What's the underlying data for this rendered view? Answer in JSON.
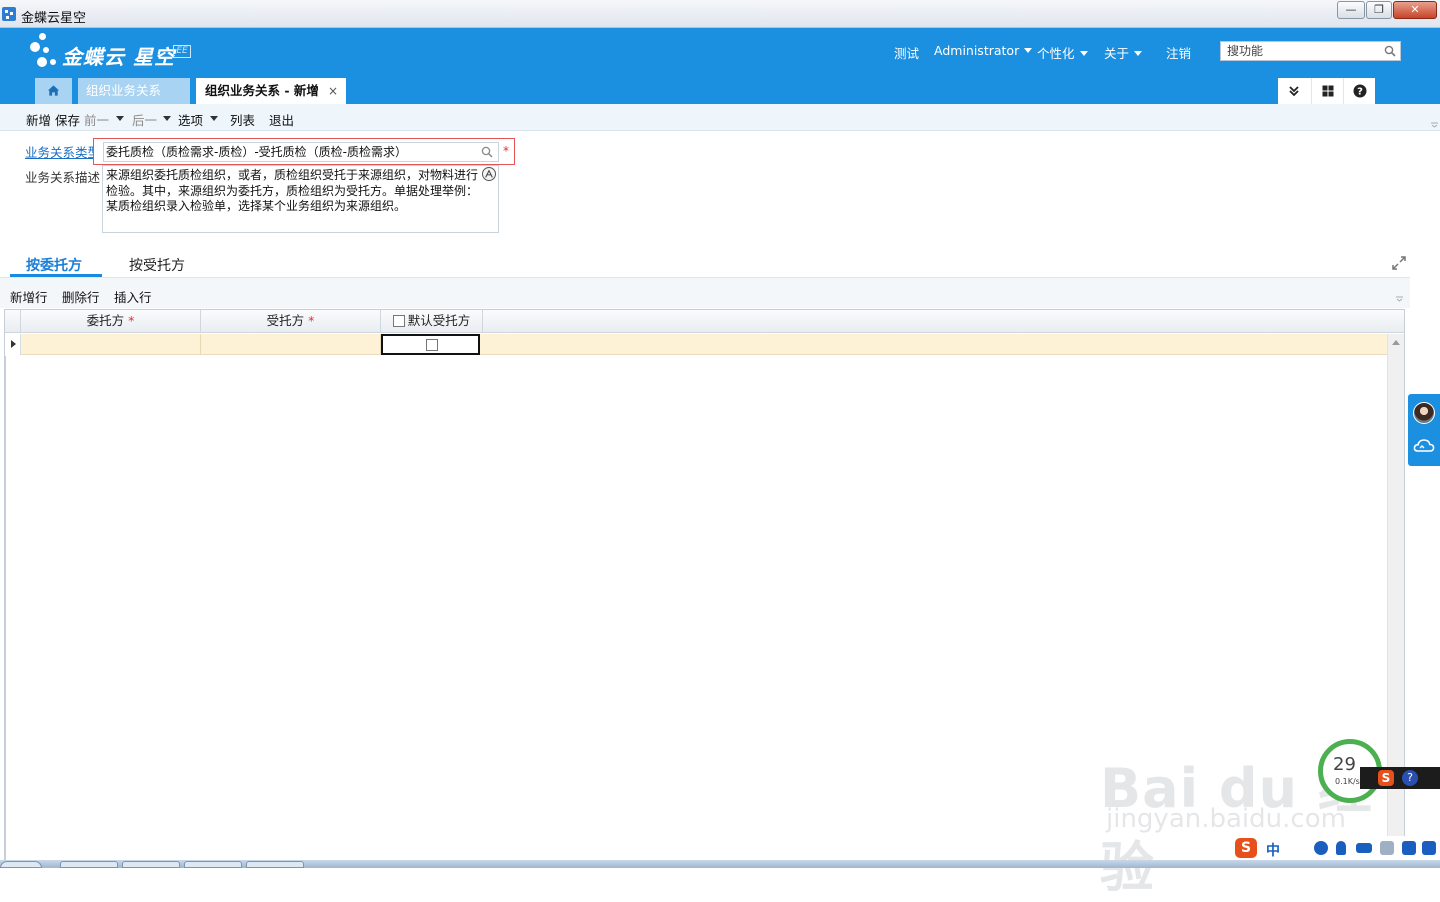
{
  "window": {
    "title": "金蝶云星空"
  },
  "header": {
    "logo_text": "金蝶云 星空",
    "logo_badge": "EE",
    "nav": {
      "test": "测试",
      "user": "Administrator",
      "personalize": "个性化",
      "about": "关于",
      "logout": "注销"
    },
    "search_placeholder": "搜功能"
  },
  "tabs": {
    "org_relation": "组织业务关系",
    "current": "组织业务关系 - 新增",
    "close": "×"
  },
  "toolbar": {
    "new": "新增",
    "save": "保存",
    "prev": "前一",
    "next": "后一",
    "options": "选项",
    "list": "列表",
    "exit": "退出"
  },
  "form": {
    "type_label": "业务关系类型",
    "type_value": "委托质检（质检需求-质检）-受托质检（质检-质检需求）",
    "required_mark": "*",
    "desc_label": "业务关系描述",
    "desc_value": "来源组织委托质检组织，或者，质检组织受托于来源组织，对物料进行检验。其中，来源组织为委托方，质检组织为受托方。单据处理举例：某质检组织录入检验单，选择某个业务组织为来源组织。"
  },
  "subtabs": {
    "by_principal": "按委托方",
    "by_agent": "按受托方"
  },
  "entry_toolbar": {
    "add_row": "新增行",
    "delete_row": "删除行",
    "insert_row": "插入行"
  },
  "grid": {
    "columns": {
      "principal": "委托方",
      "agent": "受托方",
      "default_agent": "默认受托方"
    },
    "required_mark": "*",
    "rows": [
      {
        "principal": "",
        "agent": "",
        "default_agent": false
      }
    ]
  },
  "overlay": {
    "watermark_main": "Bai du 经验",
    "watermark_sub": "jingyan.baidu.com",
    "speed_value": "29",
    "speed_unit": "0.1K/s",
    "ime_mode": "中"
  },
  "colors": {
    "header_blue": "#1b8fe0",
    "row_highlight": "#fdf2d6",
    "required_red": "#e03030"
  }
}
